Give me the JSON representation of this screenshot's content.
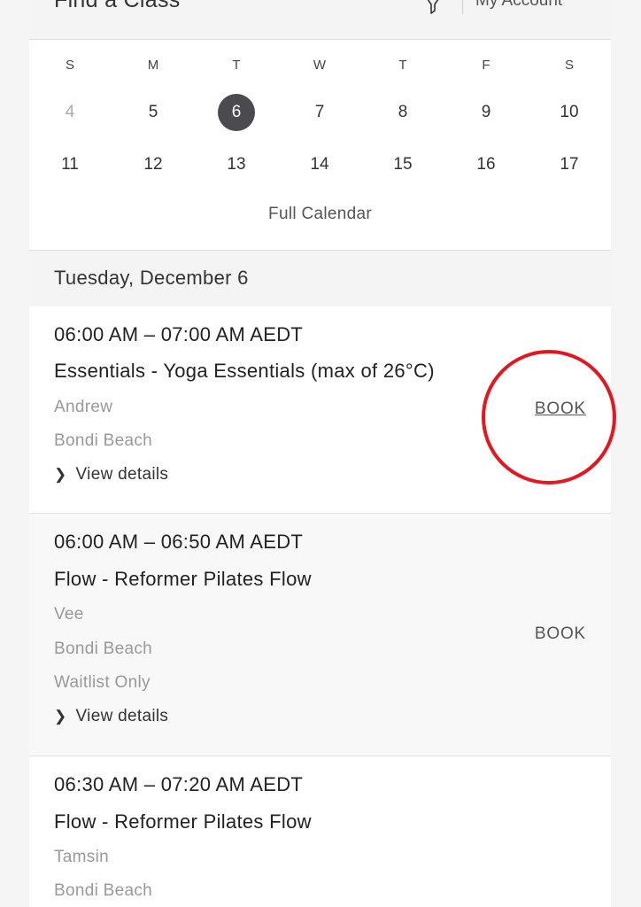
{
  "header": {
    "title": "Find a Class",
    "filter_icon": "filter-funnel-icon",
    "account": "My Account"
  },
  "calendar": {
    "weekdays": [
      "S",
      "M",
      "T",
      "W",
      "T",
      "F",
      "S"
    ],
    "weeks": [
      [
        "4",
        "5",
        "6",
        "7",
        "8",
        "9",
        "10"
      ],
      [
        "11",
        "12",
        "13",
        "14",
        "15",
        "16",
        "17"
      ]
    ],
    "selected": "6",
    "selected_color": "#4a4a4f",
    "full_calendar": "Full Calendar"
  },
  "date_heading": "Tuesday, December 6",
  "classes": [
    {
      "time": "06:00 AM – 07:00 AM AEDT",
      "title": "Essentials - Yoga Essentials (max of 26°C)",
      "instructor": "Andrew",
      "location": "Bondi Beach",
      "details": "View details",
      "book": "BOOK"
    },
    {
      "time": "06:00 AM – 06:50 AM AEDT",
      "title": "Flow - Reformer Pilates Flow",
      "instructor": "Vee",
      "location": "Bondi Beach",
      "status": "Waitlist Only",
      "details": "View details",
      "book": "BOOK"
    },
    {
      "time": "06:30 AM – 07:20 AM AEDT",
      "title": "Flow - Reformer Pilates Flow",
      "instructor": "Tamsin",
      "location": "Bondi Beach"
    }
  ],
  "annotation_color": "#e5161f"
}
